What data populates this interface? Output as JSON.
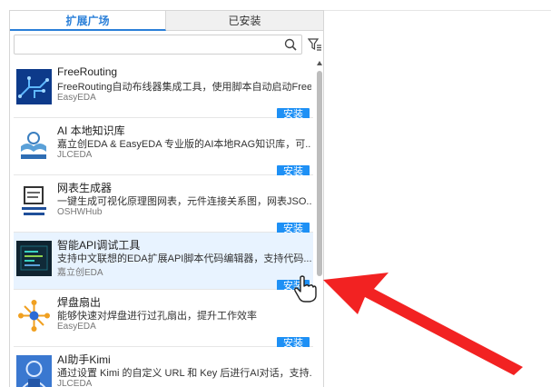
{
  "tabs": {
    "active": "扩展广场",
    "inactive": "已安装"
  },
  "search": {
    "placeholder": ""
  },
  "install_label": "安装",
  "accent": "#1e90f5",
  "items": [
    {
      "name": "FreeRouting",
      "desc": "FreeRouting自动布线器集成工具，使用脚本自动启动Free...",
      "author": "EasyEDA",
      "icon": "routing-icon"
    },
    {
      "name": "AI 本地知识库",
      "desc": "嘉立创EDA & EasyEDA 专业版的AI本地RAG知识库，可...",
      "author": "JLCEDA",
      "icon": "ai-library-icon"
    },
    {
      "name": "网表生成器",
      "desc": "一键生成可视化原理图网表，元件连接关系图，网表JSO...",
      "author": "OSHWHub",
      "icon": "netlist-explorer-icon"
    },
    {
      "name": "智能API调试工具",
      "desc": "支持中文联想的EDA扩展API脚本代码编辑器，支持代码...",
      "author": "嘉立创EDA",
      "icon": "code-editor-icon"
    },
    {
      "name": "焊盘扇出",
      "desc": "能够快速对焊盘进行过孔扇出，提升工作效率",
      "author": "EasyEDA",
      "icon": "fanout-icon"
    },
    {
      "name": "AI助手Kimi",
      "desc": "通过设置 Kimi 的自定义 URL 和 Key 后进行AI对话，支持...",
      "author": "JLCEDA",
      "icon": "ai-assistant-icon"
    }
  ]
}
